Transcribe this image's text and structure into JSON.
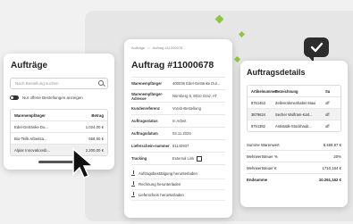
{
  "colors": {
    "accent": "#8dc63f",
    "dark": "#2d2d2d"
  },
  "orders": {
    "title": "Aufträge",
    "search_placeholder": "Nach Bestellung suchen",
    "toggle_label": "Nur offene Bestellungen anzeigen",
    "columns": [
      "Warenempfänger",
      "Betrag"
    ],
    "rows": [
      {
        "name": "Edel-Getränke Du...",
        "amount": "1.024,00 €"
      },
      {
        "name": "Bio-Teilk Arbeitsa...",
        "amount": "658,50 €"
      },
      {
        "name": "Alpiar Innovationsb...",
        "amount": "2.200,00 €"
      }
    ]
  },
  "detail": {
    "breadcrumb": [
      "Aufträge",
      ">",
      "Auftrag #11000678"
    ],
    "title": "Auftrag #11000678",
    "fields": [
      {
        "label": "Warenempfänger",
        "value": "400036 Edel-Getränke Dur..."
      },
      {
        "label": "Warenempfänger-Adresse",
        "value": "Nürnberg 5, 8010 Graz, AT"
      },
      {
        "label": "Kundenreferenz",
        "value": "Vorab-Bestellung"
      },
      {
        "label": "Auftragsstatus",
        "value": "In Arbeit"
      },
      {
        "label": "Auftragsdatum",
        "value": "03.11.2025"
      },
      {
        "label": "Lieferschein-nummer",
        "value": "81140937"
      }
    ],
    "tracking_label": "Tracking",
    "tracking_link": "External Link",
    "actions": [
      "Auftragsbestätigung herunterladen",
      "Rechnung herunterladen",
      "Lieferschein herunterladen"
    ]
  },
  "order_details": {
    "title": "Auftragsdetails",
    "columns": [
      "Artikelnummer",
      "Bezeichnung",
      "Su"
    ],
    "rows": [
      {
        "id": "8751463",
        "desc": "Zellenrahmenhalter Maxi",
        "c": "off"
      },
      {
        "id": "3879634",
        "desc": "Secher Wolfram-Kart...",
        "c": "off"
      },
      {
        "id": "8751382",
        "desc": "Antistatik-Stockhaub...",
        "c": "off"
      }
    ],
    "totals": [
      {
        "label": "Summe Warenwert",
        "value": "8.469,97 €"
      },
      {
        "label": "Mehrwertsteuer %",
        "value": "20%"
      },
      {
        "label": "Mehrwertsteuer €",
        "value": "1710,164 €"
      },
      {
        "label": "Endsumme",
        "value": "10.261,162 €"
      }
    ]
  }
}
